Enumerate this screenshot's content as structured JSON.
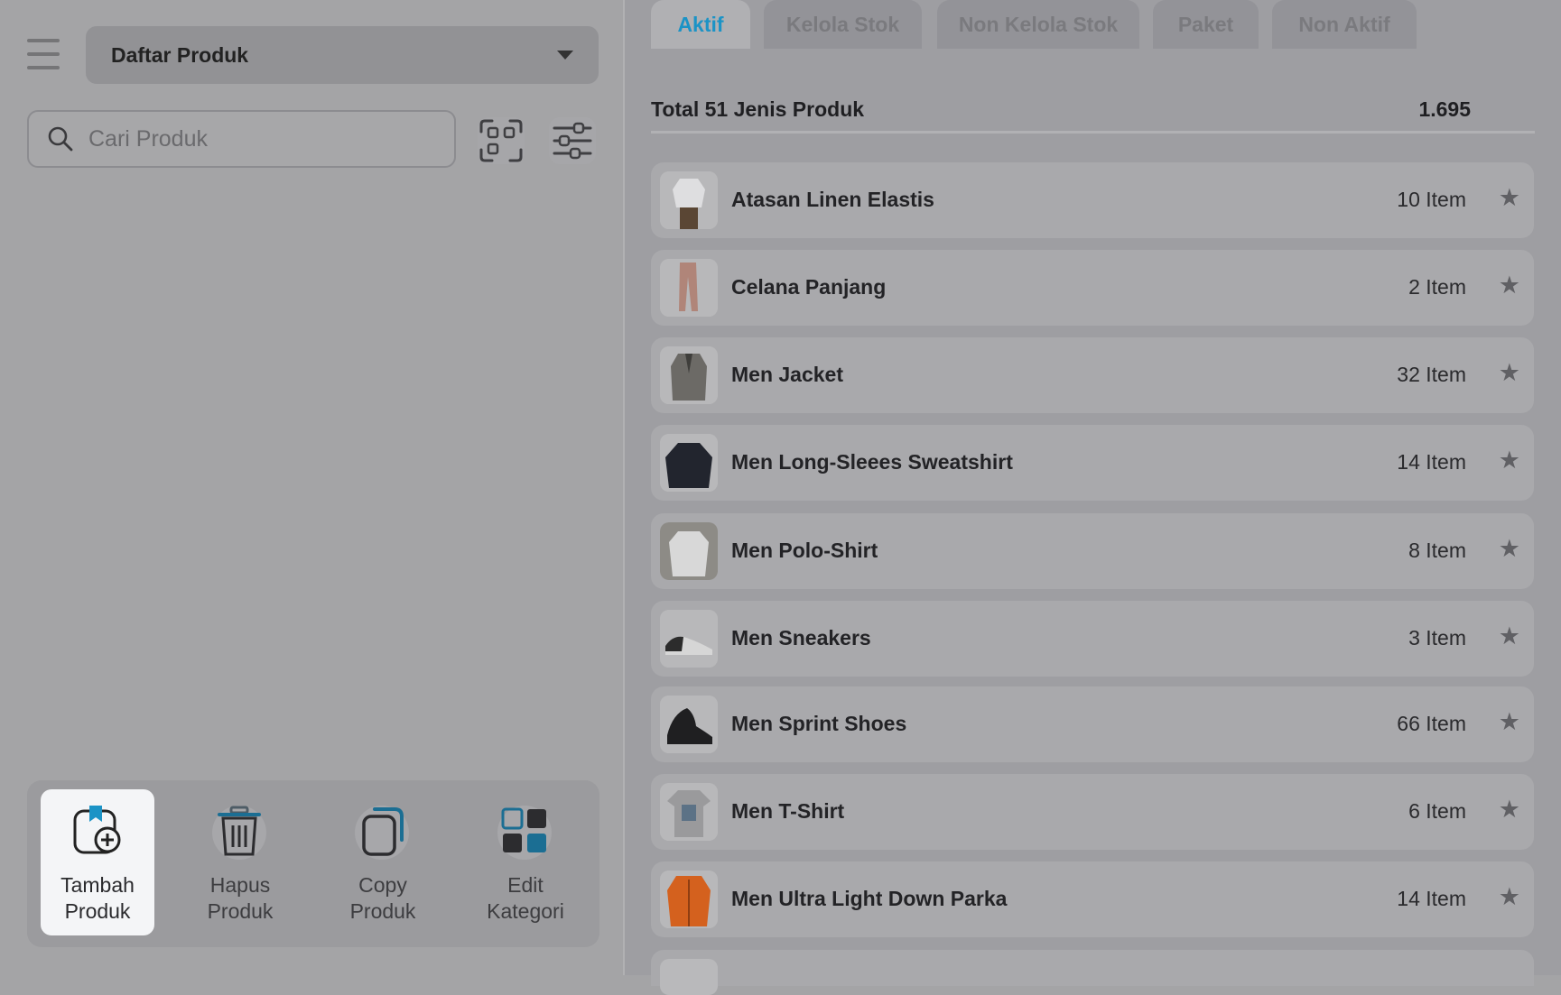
{
  "header": {
    "dropdown_label": "Daftar Produk",
    "search_placeholder": "Cari Produk"
  },
  "actions": [
    {
      "line1": "Tambah",
      "line2": "Produk",
      "icon": "add-product-icon",
      "active": true
    },
    {
      "line1": "Hapus",
      "line2": "Produk",
      "icon": "trash-icon",
      "active": false
    },
    {
      "line1": "Copy",
      "line2": "Produk",
      "icon": "copy-icon",
      "active": false
    },
    {
      "line1": "Edit",
      "line2": "Kategori",
      "icon": "category-grid-icon",
      "active": false
    }
  ],
  "tabs": [
    {
      "label": "Aktif",
      "active": true
    },
    {
      "label": "Kelola Stok",
      "active": false
    },
    {
      "label": "Non Kelola Stok",
      "active": false
    },
    {
      "label": "Paket",
      "active": false
    },
    {
      "label": "Non Aktif",
      "active": false
    }
  ],
  "summary": {
    "total_label": "Total 51 Jenis Produk",
    "total_value": "1.695"
  },
  "products": [
    {
      "name": "Atasan Linen Elastis",
      "count": "10 Item"
    },
    {
      "name": "Celana Panjang",
      "count": "2 Item"
    },
    {
      "name": "Men Jacket",
      "count": "32 Item"
    },
    {
      "name": "Men Long-Sleees Sweatshirt",
      "count": "14 Item"
    },
    {
      "name": "Men Polo-Shirt",
      "count": "8 Item"
    },
    {
      "name": "Men Sneakers",
      "count": "3 Item"
    },
    {
      "name": "Men Sprint Shoes",
      "count": "66 Item"
    },
    {
      "name": "Men T-Shirt",
      "count": "6 Item"
    },
    {
      "name": "Men Ultra Light Down Parka",
      "count": "14 Item"
    }
  ],
  "colors": {
    "accent": "#1b93c6",
    "overlay_bg": "#a4a4a6"
  }
}
